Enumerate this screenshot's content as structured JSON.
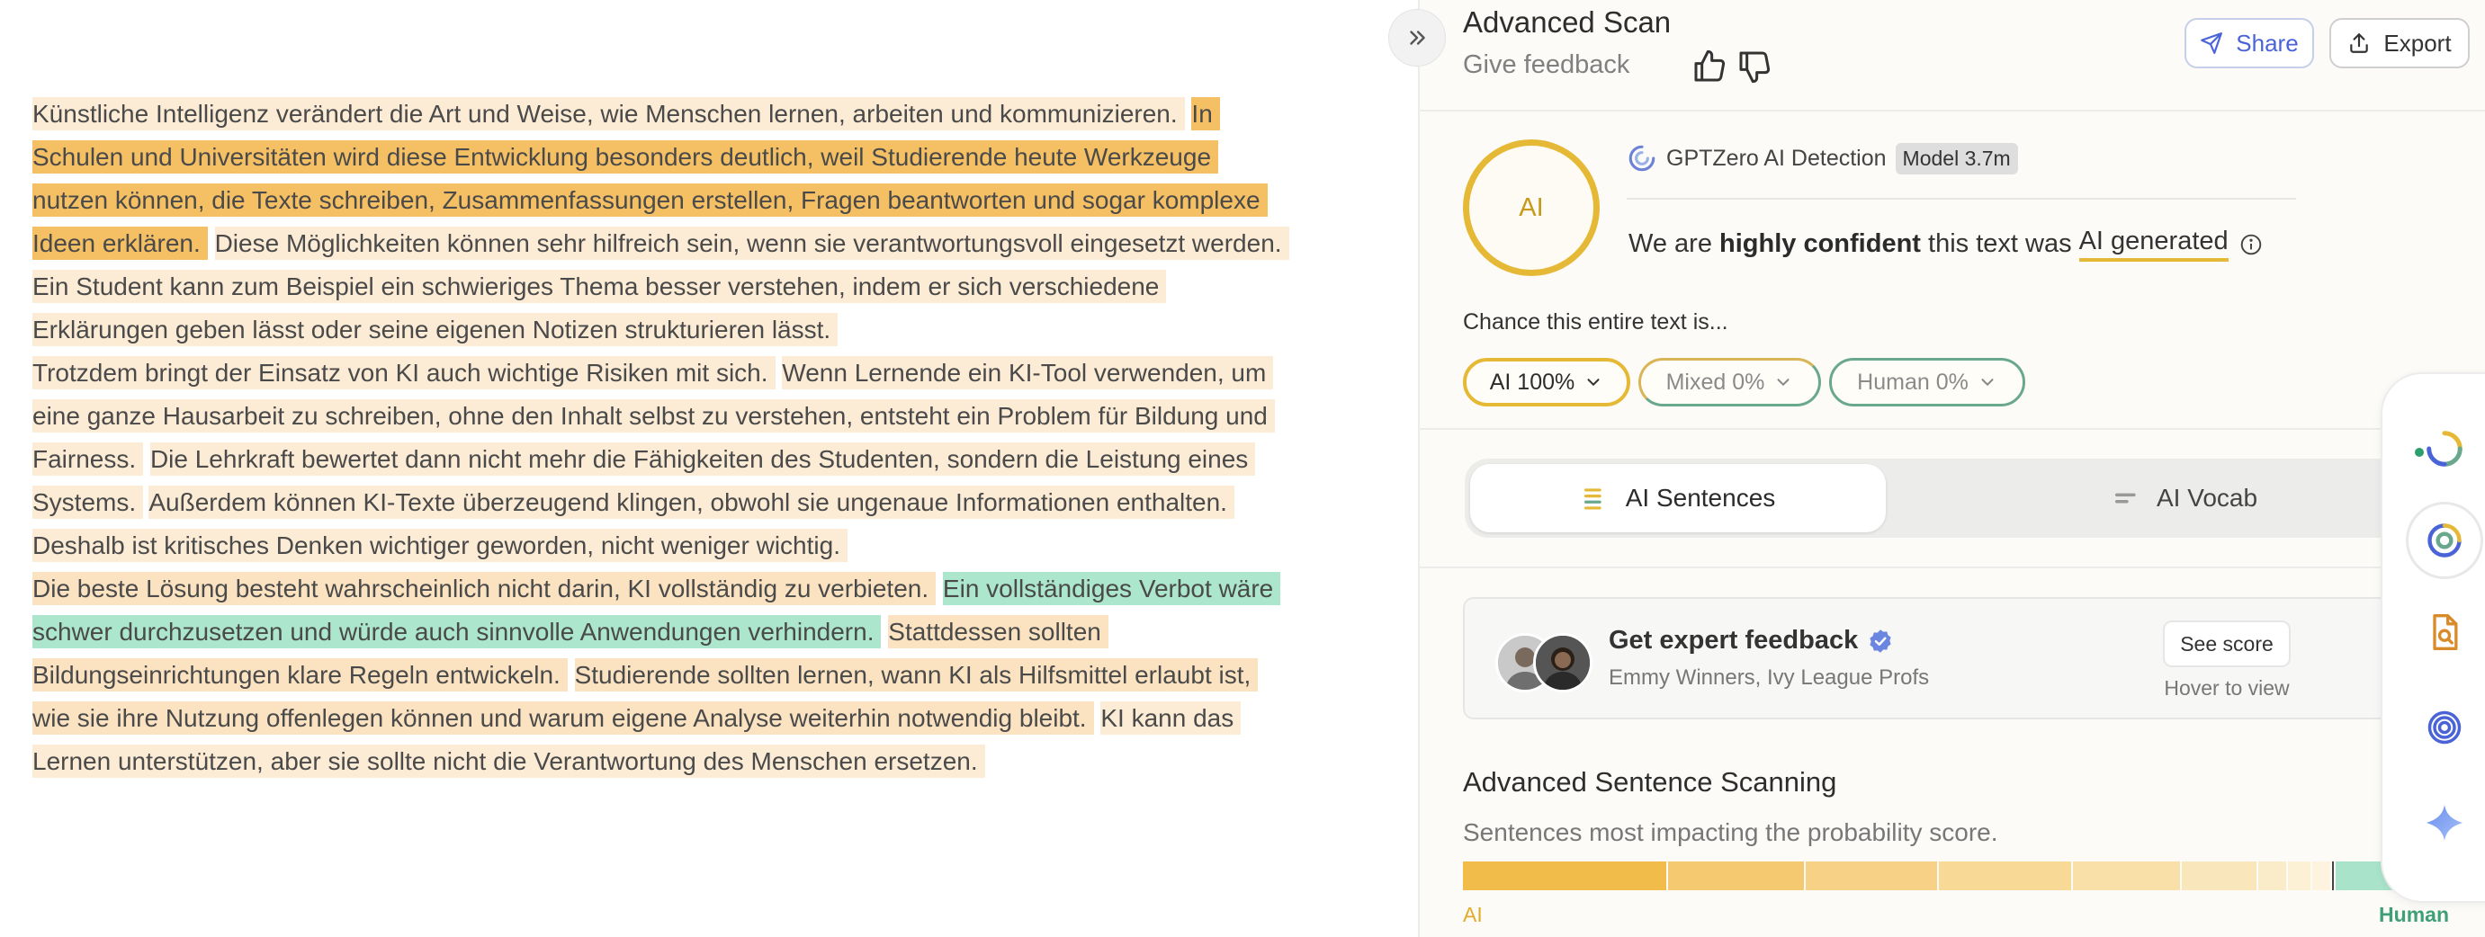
{
  "document": {
    "paragraphs": [
      [
        {
          "text": "Künstliche Intelligenz verändert die Art und Weise, wie Menschen lernen, arbeiten und kommunizieren.",
          "level": "l"
        },
        {
          "text": "In Schulen und Universitäten wird diese Entwicklung besonders deutlich, weil Studierende heute Werkzeuge nutzen können, die Texte schreiben, Zusammenfassungen erstellen, Fragen beantworten und sogar komplexe Ideen erklären.",
          "level": "h"
        },
        {
          "text": "Diese Möglichkeiten können sehr hilfreich sein, wenn sie verantwortungsvoll eingesetzt werden.",
          "level": "l"
        },
        {
          "text": "Ein Student kann zum Beispiel ein schwieriges Thema besser verstehen, indem er sich verschiedene Erklärungen geben lässt oder seine eigenen Notizen strukturieren lässt.",
          "level": "l"
        }
      ],
      [
        {
          "text": "Trotzdem bringt der Einsatz von KI auch wichtige Risiken mit sich.",
          "level": "l"
        },
        {
          "text": "Wenn Lernende ein KI-Tool verwenden, um eine ganze Hausarbeit zu schreiben, ohne den Inhalt selbst zu verstehen, entsteht ein Problem für Bildung und Fairness.",
          "level": "l"
        },
        {
          "text": "Die Lehrkraft bewertet dann nicht mehr die Fähigkeiten des Studenten, sondern die Leistung eines Systems.",
          "level": "l"
        },
        {
          "text": "Außerdem können KI-Texte überzeugend klingen, obwohl sie ungenaue Informationen enthalten.",
          "level": "l"
        },
        {
          "text": "Deshalb ist kritisches Denken wichtiger geworden, nicht weniger wichtig.",
          "level": "l"
        }
      ],
      [
        {
          "text": "Die beste Lösung besteht wahrscheinlich nicht darin, KI vollständig zu verbieten.",
          "level": "m"
        },
        {
          "text": "Ein vollständiges Verbot wäre schwer durchzusetzen und würde auch sinnvolle Anwendungen verhindern.",
          "level": "g"
        },
        {
          "text": "Stattdessen sollten Bildungseinrichtungen klare Regeln entwickeln.",
          "level": "m"
        },
        {
          "text": "Studierende sollten lernen, wann KI als Hilfsmittel erlaubt ist, wie sie ihre Nutzung offenlegen können und warum eigene Analyse weiterhin notwendig bleibt.",
          "level": "m"
        },
        {
          "text": "KI kann das Lernen unterstützen, aber sie sollte nicht die Verantwortung des Menschen ersetzen.",
          "level": "l"
        }
      ]
    ]
  },
  "header": {
    "title": "Advanced Scan",
    "feedback_label": "Give feedback",
    "share_label": "Share",
    "export_label": "Export"
  },
  "result": {
    "ring_label": "AI",
    "detector_name": "GPTZero AI Detection",
    "model_badge": "Model 3.7m",
    "confidence_prefix": "We are",
    "confidence_strong": "highly confident",
    "confidence_middle": "this text was",
    "confidence_verdict": "AI generated"
  },
  "chance": {
    "label": "Chance this entire text is...",
    "ai": "AI 100%",
    "mixed": "Mixed 0%",
    "human": "Human 0%"
  },
  "tabs": {
    "sentences": "AI Sentences",
    "vocab": "AI Vocab"
  },
  "expert": {
    "title": "Get expert feedback",
    "subtitle": "Emmy Winners, Ivy League Profs",
    "see_score": "See score",
    "hover": "Hover to view"
  },
  "scanning": {
    "heading": "Advanced Sentence Scanning",
    "subtitle": "Sentences most impacting the probability score.",
    "ai_label": "AI",
    "human_label": "Human",
    "segments": [
      {
        "share": 0.208,
        "color": "#f2bc4a"
      },
      {
        "share": 0.14,
        "color": "#f5c970"
      },
      {
        "share": 0.135,
        "color": "#f7d286"
      },
      {
        "share": 0.136,
        "color": "#f8d996"
      },
      {
        "share": 0.11,
        "color": "#f9dfa8"
      },
      {
        "share": 0.078,
        "color": "#fae6bb"
      },
      {
        "share": 0.03,
        "color": "#fbecc9"
      },
      {
        "share": 0.025,
        "color": "#fcf0d5"
      },
      {
        "share": 0.02,
        "color": "#fdf3de"
      },
      {
        "share": 0.004,
        "color": "#444444"
      },
      {
        "share": 0.099,
        "color": "#a9e3ca"
      }
    ]
  },
  "colors": {
    "ai_yellow": "#e5b935",
    "human_green": "#6aa88d",
    "share_blue": "#4a64d8"
  }
}
